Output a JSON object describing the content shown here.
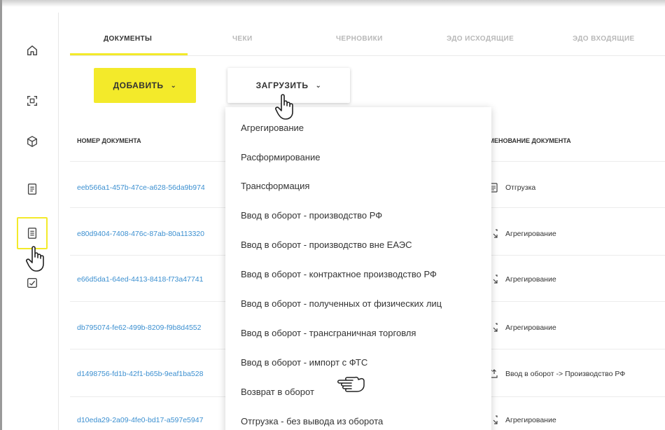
{
  "sidebar": {
    "items": [
      {
        "icon": "home-icon",
        "name": "home"
      },
      {
        "icon": "scan-icon",
        "name": "scan"
      },
      {
        "icon": "box-icon",
        "name": "products"
      },
      {
        "icon": "register-icon",
        "name": "registry"
      },
      {
        "icon": "document-icon",
        "name": "documents",
        "active": true
      },
      {
        "icon": "check-icon",
        "name": "check"
      }
    ]
  },
  "tabs": [
    {
      "label": "ДОКУМЕНТЫ",
      "active": true
    },
    {
      "label": "ЧЕКИ",
      "active": false
    },
    {
      "label": "ЧЕРНОВИКИ",
      "active": false
    },
    {
      "label": "ЭДО ИСХОДЯЩИЕ",
      "active": false
    },
    {
      "label": "ЭДО ВХОДЯЩИЕ",
      "active": false
    }
  ],
  "toolbar": {
    "add_label": "ДОБАВИТЬ",
    "load_label": "ЗАГРУЗИТЬ"
  },
  "table": {
    "headers": {
      "number": "НОМЕР ДОКУМЕНТА",
      "name": "ИМЕНОВАНИЕ ДОКУМЕНТА"
    },
    "rows": [
      {
        "number": "eeb566a1-457b-47ce-a628-56da9b974",
        "name": "Отгрузка",
        "icon": "doc-lines-icon"
      },
      {
        "number": "e80d9404-7408-476c-87ab-80a113320",
        "name": "Агрегирование",
        "icon": "aggregate-icon"
      },
      {
        "number": "e66d5da1-64ed-4413-8418-f73a47741",
        "name": "Агрегирование",
        "icon": "aggregate-icon"
      },
      {
        "number": "db795074-fe62-499b-8209-f9b8d4552",
        "name": "Агрегирование",
        "icon": "aggregate-icon"
      },
      {
        "number": "d1498756-fd1b-42f1-b65b-9eaf1ba528",
        "name": "Ввод в оборот -> Производство РФ",
        "icon": "introduce-icon"
      },
      {
        "number": "d10eda29-2a09-4fe0-bd17-a597e5947",
        "name": "Агрегирование",
        "icon": "aggregate-icon"
      }
    ]
  },
  "dropdown": {
    "items": [
      "Агрегирование",
      "Расформирование",
      "Трансформация",
      "Ввод в оборот - производство РФ",
      "Ввод в оборот - производство вне ЕАЭС",
      "Ввод в оборот - контрактное производство РФ",
      "Ввод в оборот - полученных от физических лиц",
      "Ввод в оборот - трансграничная торговля",
      "Ввод в оборот - импорт с ФТС",
      "Возврат в оборот",
      "Отгрузка - без вывода из оборота"
    ]
  },
  "colors": {
    "accent": "#f3ea2a",
    "link": "#3b8fd0",
    "text": "#333333",
    "muted": "#b8b8b8"
  }
}
